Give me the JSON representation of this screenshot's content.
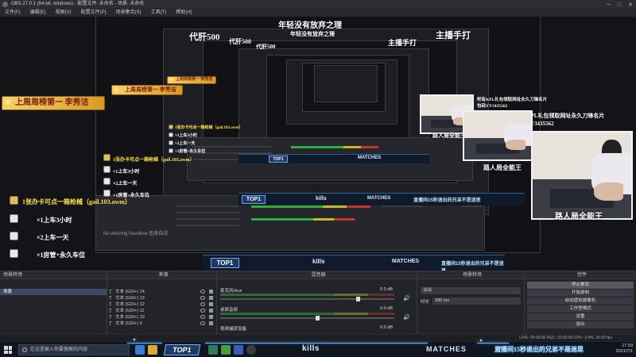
{
  "window": {
    "title": "OBS 27.0.1 (64-bit, windows) - 配置文件: 未命名 - 场景: 未命名"
  },
  "menu": [
    "文件(F)",
    "编辑(E)",
    "视图(V)",
    "配置文件(P)",
    "场景集合(S)",
    "工具(T)",
    "帮助(H)"
  ],
  "overlay": {
    "title_top": "年轻没有放弃之理",
    "left_banner_top": "代肝500",
    "right_banner_top": "主播手打",
    "ribbon": "上周周榜第一 李秀洁",
    "checklist_intro": "1张办卡可点一箱枪械（gail.103.awm）",
    "checklist_items": [
      "×1上车3小时",
      "×2上车一天",
      "×1房管+永久车位"
    ],
    "promo_line1": "吧有KPL礼包领取网址永久刀锋名片",
    "promo_line2": "包码YY3435562",
    "cam_label": "路人局全能王",
    "kills_label": "kills",
    "matches_label": "MATCHES",
    "top_badge": "TOP1",
    "ticker": "直播间15秒退出的兄弟不是迷思",
    "source_hint": "No whoring foundree 拒绝自说"
  },
  "docks": {
    "scenes": {
      "title": "场景转场",
      "items": [
        "场景"
      ]
    },
    "sources": {
      "title": "来源",
      "items": [
        "文本 (GDI+) 14",
        "文本 (GDI+) 13",
        "文本 (GDI+) 12",
        "文本 (GDI+) 11",
        "文本 (GDI+) 10",
        "文本 (GDI+) 9"
      ]
    },
    "mixer": {
      "title": "混音器",
      "tracks": [
        {
          "name": "麦克风/Aux",
          "db": "0.0 dB"
        },
        {
          "name": "桌面音频",
          "db": "0.0 dB"
        },
        {
          "name": "视频捕获设备",
          "db": "0.0 dB"
        }
      ]
    },
    "transitions": {
      "title": "场景转场",
      "type": "淡出",
      "duration_label": "时长",
      "duration": "300 ms"
    },
    "controls": {
      "title": "控件",
      "buttons": [
        "停止推流",
        "开始录制",
        "启动虚拟摄像机",
        "工作室模式",
        "设置",
        "退出"
      ]
    }
  },
  "status": {
    "text": "LIVE: 00:00:00  REC: 00:00:00  CPU: 3.4%, 30.00 fps"
  },
  "taskbar": {
    "search_placeholder": "在这里输入你要搜索的内容",
    "time": "17:33",
    "date": "2021/7/1"
  }
}
